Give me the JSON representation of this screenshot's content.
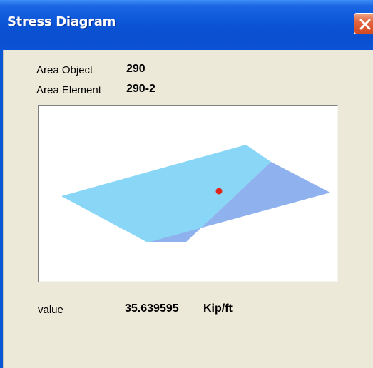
{
  "window": {
    "title": "Stress Diagram"
  },
  "info": {
    "area_object_label": "Area Object",
    "area_object_value": "290",
    "area_element_label": "Area Element",
    "area_element_value": "290-2"
  },
  "result": {
    "label": "value",
    "value": "35.639595",
    "unit": "Kip/ft"
  },
  "diagram": {
    "colors": {
      "plate_light": "#89d6f7",
      "plate_dark": "#8fb2ee",
      "marker": "#e2231a"
    }
  },
  "icons": {
    "close": "close-icon"
  }
}
